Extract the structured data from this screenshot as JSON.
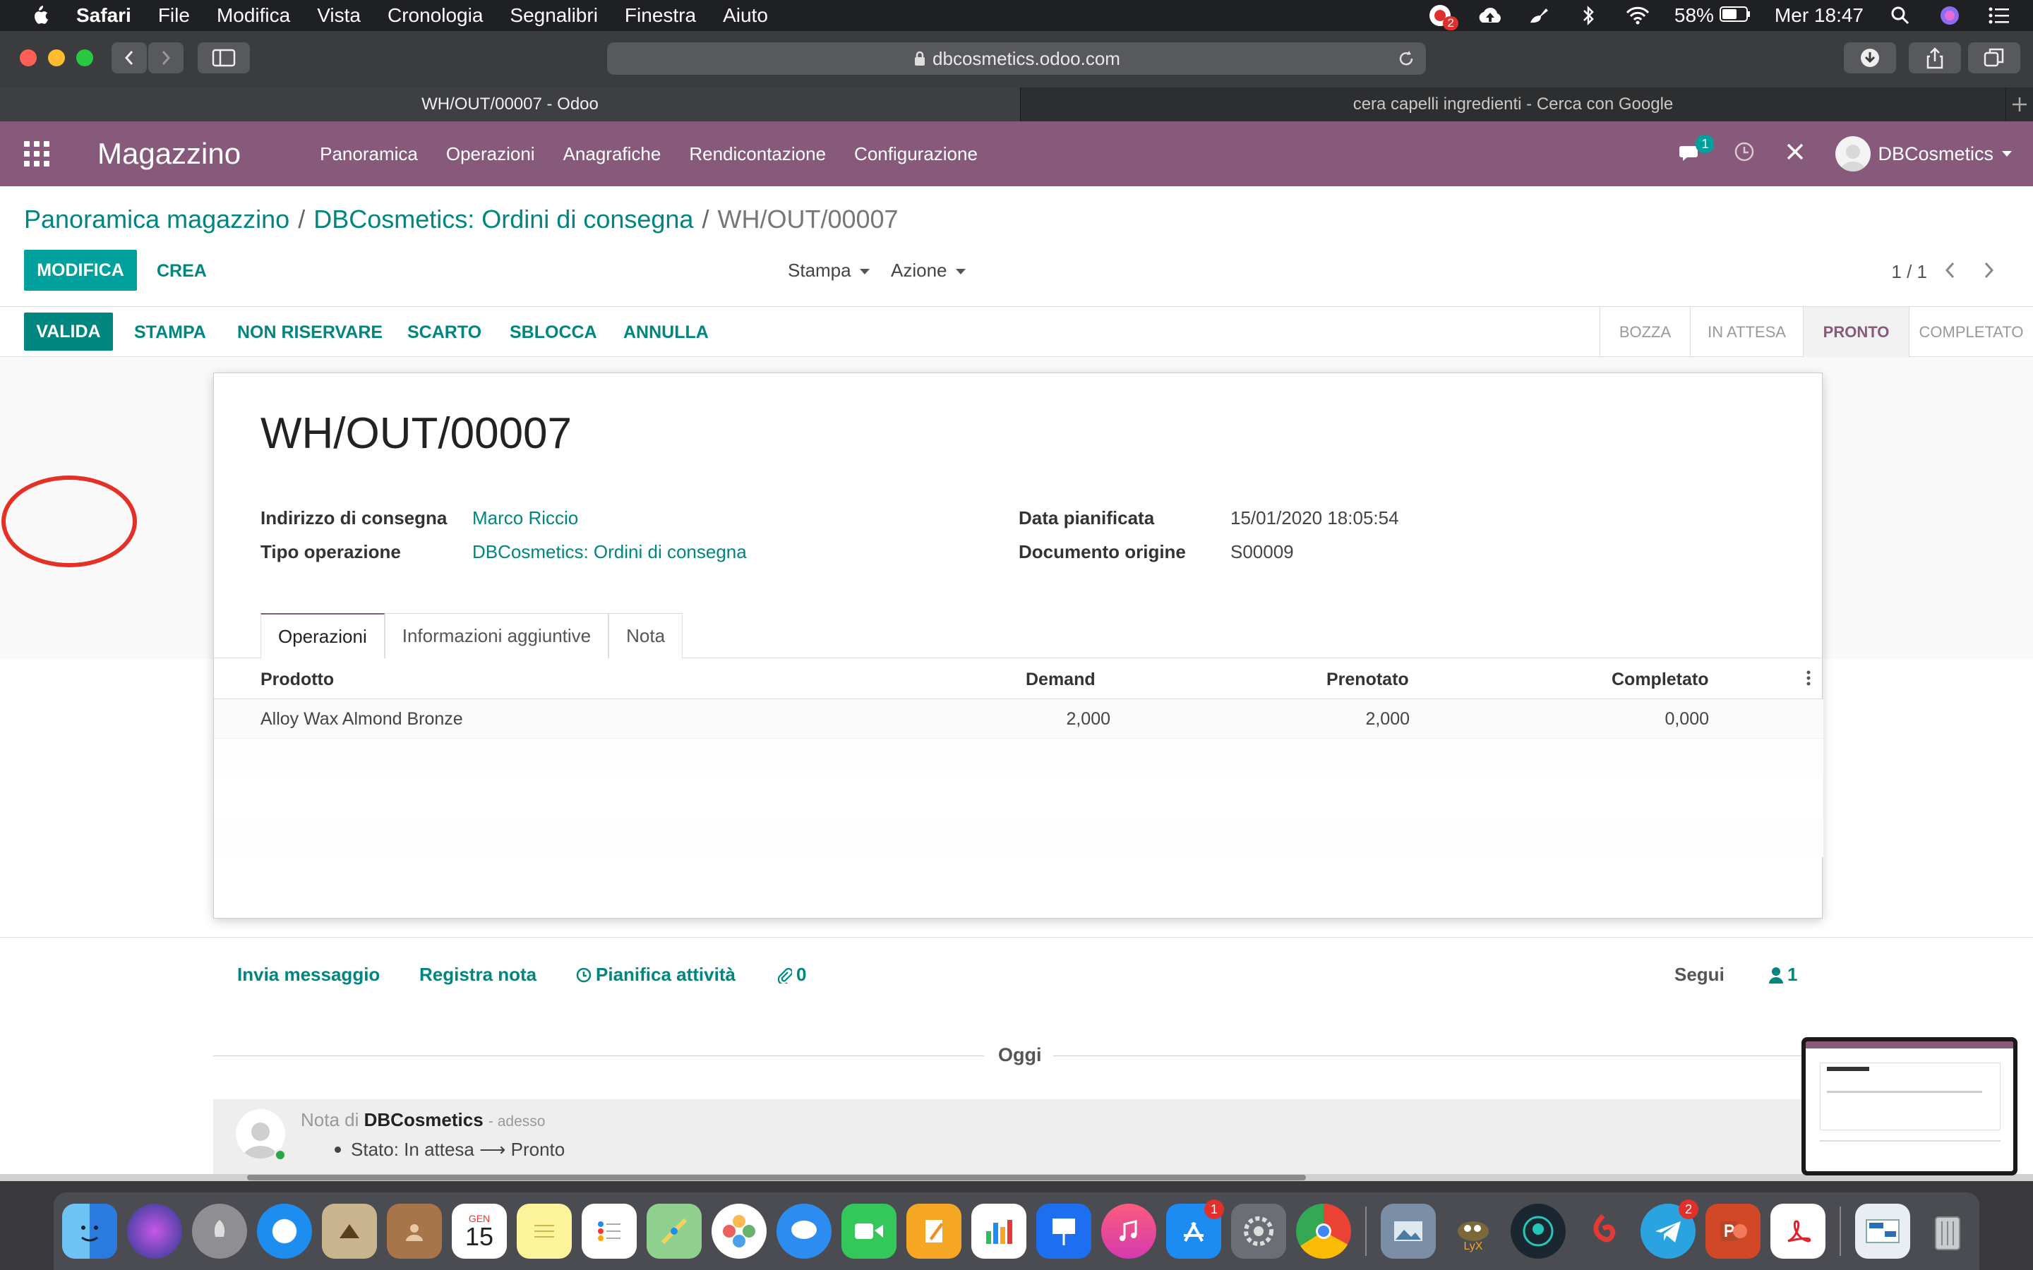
{
  "menubar": {
    "app": "Safari",
    "items": [
      "File",
      "Modifica",
      "Vista",
      "Cronologia",
      "Segnalibri",
      "Finestra",
      "Aiuto"
    ],
    "battery": "58%",
    "clock": "Mer 18:47",
    "notif_badge": "2"
  },
  "safari": {
    "url": "dbcosmetics.odoo.com",
    "tabs": [
      "WH/OUT/00007 - Odoo",
      "cera capelli ingredienti - Cerca con Google"
    ]
  },
  "odoo": {
    "brand": "Magazzino",
    "menus": [
      "Panoramica",
      "Operazioni",
      "Anagrafiche",
      "Rendicontazione",
      "Configurazione"
    ],
    "chat_badge": "1",
    "company": "DBCosmetics"
  },
  "breadcrumb": {
    "level1": "Panoramica magazzino",
    "level2": "DBCosmetics: Ordini di consegna",
    "current": "WH/OUT/00007",
    "sep": "/"
  },
  "controls": {
    "edit": "MODIFICA",
    "create": "CREA",
    "print": "Stampa",
    "action": "Azione",
    "pager": "1 / 1"
  },
  "statusbar": {
    "buttons": [
      "VALIDA",
      "STAMPA",
      "NON RISERVARE",
      "SCARTO",
      "SBLOCCA",
      "ANNULLA"
    ],
    "stages": [
      "BOZZA",
      "IN ATTESA",
      "PRONTO",
      "COMPLETATO"
    ],
    "active_stage": "PRONTO"
  },
  "form": {
    "title": "WH/OUT/00007",
    "fields": {
      "partner_label": "Indirizzo di consegna",
      "partner_value": "Marco Riccio",
      "optype_label": "Tipo operazione",
      "optype_value": "DBCosmetics: Ordini di consegna",
      "date_label": "Data pianificata",
      "date_value": "15/01/2020 18:05:54",
      "origin_label": "Documento origine",
      "origin_value": "S00009"
    },
    "tabs": [
      "Operazioni",
      "Informazioni aggiuntive",
      "Nota"
    ],
    "table": {
      "headers": [
        "Prodotto",
        "Demand",
        "Prenotato",
        "Completato"
      ],
      "rows": [
        [
          "Alloy Wax Almond Bronze",
          "2,000",
          "2,000",
          "0,000"
        ]
      ]
    }
  },
  "chatter": {
    "send": "Invia messaggio",
    "log": "Registra nota",
    "schedule": "Pianifica attività",
    "attachments": "0",
    "follow": "Segui",
    "followers": "1",
    "today": "Oggi",
    "msg_prefix": "Nota di",
    "msg_author": "DBCosmetics",
    "msg_time": "- adesso",
    "msg_body": "Stato: In attesa ⟶ Pronto"
  },
  "dock": {
    "calendar_month": "GEN",
    "calendar_day": "15",
    "badges": {
      "appstore": "1",
      "telegram": "2"
    }
  },
  "colors": {
    "odoo_purple": "#875a7b",
    "odoo_teal": "#00a09d",
    "annotation_red": "#e53026"
  }
}
